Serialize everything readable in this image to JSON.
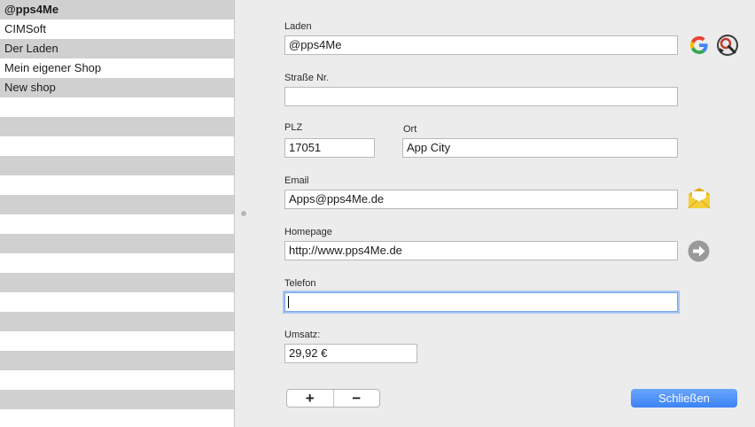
{
  "sidebar": {
    "items": [
      {
        "label": "@pps4Me"
      },
      {
        "label": "CIMSoft"
      },
      {
        "label": "Der Laden"
      },
      {
        "label": "Mein eigener Shop"
      },
      {
        "label": "New shop"
      }
    ]
  },
  "form": {
    "laden_label": "Laden",
    "laden_value": "@pps4Me",
    "strasse_label": "Straße Nr.",
    "strasse_value": "",
    "plz_label": "PLZ",
    "plz_value": "17051",
    "ort_label": "Ort",
    "ort_value": "App City",
    "email_label": "Email",
    "email_value": "Apps@pps4Me.de",
    "homepage_label": "Homepage",
    "homepage_value": "http://www.pps4Me.de",
    "telefon_label": "Telefon",
    "telefon_value": "",
    "umsatz_label": "Umsatz:",
    "umsatz_value": "29,92 €"
  },
  "buttons": {
    "add_label": "+",
    "remove_label": "−",
    "close_label": "Schließen"
  },
  "icons": {
    "google": "google-icon",
    "map_search": "map-search-icon",
    "mail": "mail-envelope-icon",
    "arrow": "arrow-right-circle-icon"
  },
  "colors": {
    "accent": "#3b82f6",
    "stripe": "#d0d0d0",
    "focus": "#a6c6f2"
  }
}
